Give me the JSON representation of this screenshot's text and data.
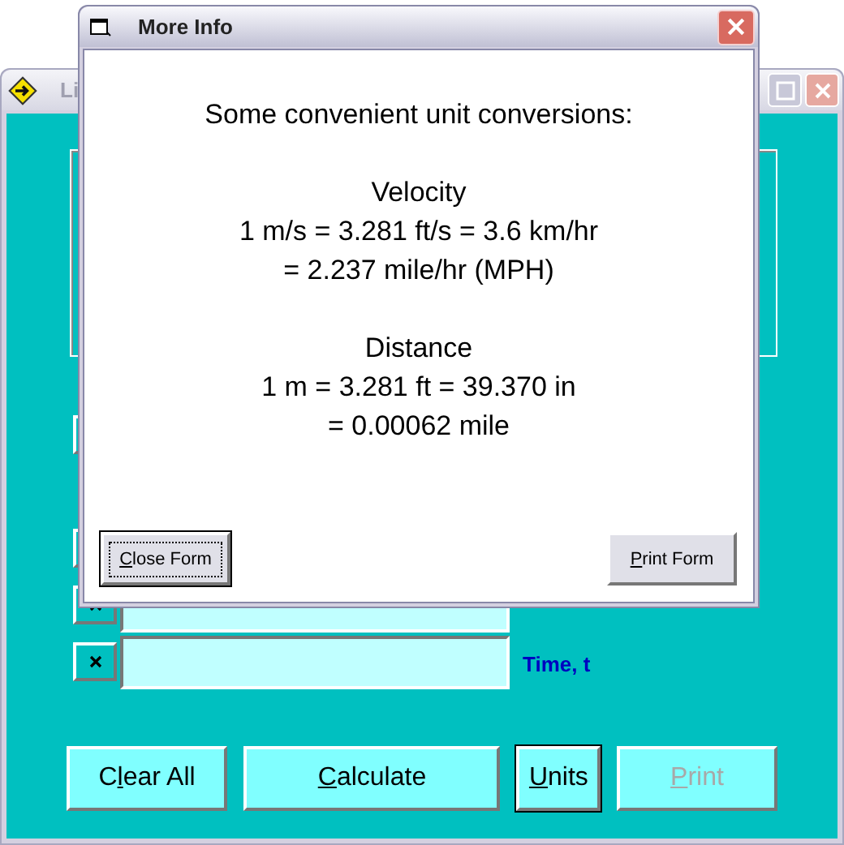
{
  "main_window": {
    "title": "Li",
    "rows": [
      {
        "kind": "box"
      },
      {
        "kind": "box"
      },
      {
        "kind": "field",
        "checked": true
      },
      {
        "kind": "field",
        "checked": true,
        "label": "Time, t"
      }
    ],
    "buttons": [
      {
        "before": "C",
        "key": "l",
        "rest": "ear All",
        "focused": false,
        "disabled": false
      },
      {
        "key": "C",
        "rest": "alculate",
        "focused": false,
        "disabled": false
      },
      {
        "key": "U",
        "rest": "nits",
        "focused": true,
        "disabled": false
      },
      {
        "key": "P",
        "rest": "rint",
        "focused": false,
        "disabled": true
      }
    ]
  },
  "dialog": {
    "title": "More Info",
    "intro": "Some convenient unit conversions:",
    "sections": [
      {
        "heading": "Velocity",
        "lines": [
          "1 m/s = 3.281 ft/s = 3.6 km/hr",
          "= 2.237 mile/hr (MPH)"
        ]
      },
      {
        "heading": "Distance",
        "lines": [
          "1 m = 3.281 ft = 39.370 in",
          "= 0.00062 mile"
        ]
      }
    ],
    "buttons": [
      {
        "key": "C",
        "rest": "lose Form",
        "focused": true
      },
      {
        "key": "P",
        "rest": "rint Form",
        "focused": false
      }
    ]
  }
}
